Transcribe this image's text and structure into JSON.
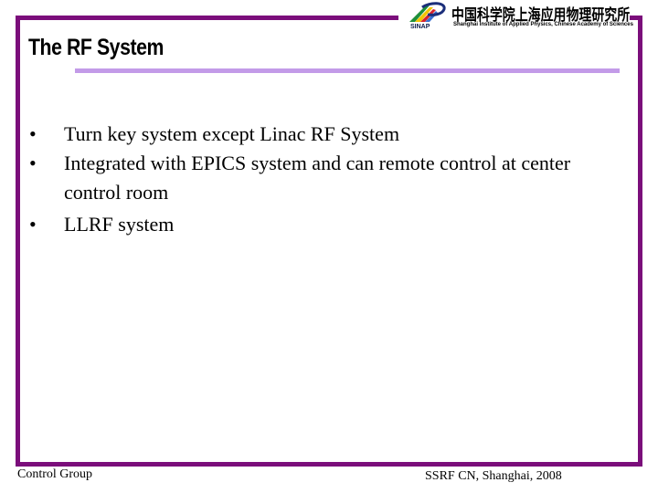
{
  "slide": {
    "title": "The RF System",
    "bullets": [
      {
        "marker": "•",
        "text": "Turn key system except Linac RF System"
      },
      {
        "marker": "•",
        "text": "Integrated  with EPICS system and can remote control at center control room"
      },
      {
        "marker": "•",
        "text": "LLRF system"
      }
    ]
  },
  "logo": {
    "acronym": "SINAP",
    "chinese_name": "中国科学院上海应用物理研究所",
    "english_name": "Shanghai Institute of Applied Physics, Chinese Academy of Sciences",
    "icon": "sinap-logo-icon"
  },
  "footer": {
    "left": "Control Group",
    "right": "SSRF CN, Shanghai, 2008"
  },
  "colors": {
    "frame": "#7b0e7b",
    "title_underline": "#c39be8"
  }
}
